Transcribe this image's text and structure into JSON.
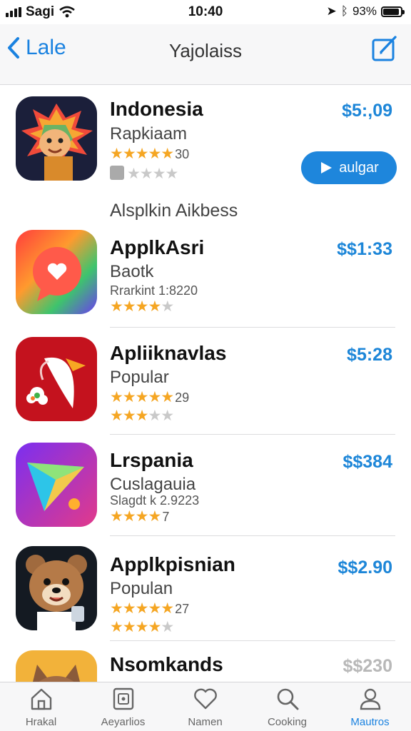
{
  "status_bar": {
    "carrier": "Sagi",
    "time": "10:40",
    "battery": "93%"
  },
  "nav": {
    "back_label": "Lale",
    "title": "Yajolaiss"
  },
  "featured": {
    "title": "Indonesia",
    "subtitle": "Rapkiaam",
    "rating_count": "30",
    "price": "$5:,09",
    "action_label": "aulgar",
    "stars": 5,
    "user_stars": 4
  },
  "section_header": "Alsplkin Aikbess",
  "apps": [
    {
      "title": "ApplkAsri",
      "subtitle": "Baotk",
      "meta": "Rrarkint 1:8220",
      "price": "$$1:33",
      "stars": 4,
      "count": ""
    },
    {
      "title": "Apliiknavlas",
      "subtitle": "Popular",
      "meta": "",
      "price": "$5:28",
      "stars": 5,
      "count": "29",
      "stars2": 3
    },
    {
      "title": "Lrspania",
      "subtitle": "Cuslagauia",
      "meta": "Slagdt k 2.9223",
      "price": "$$384",
      "stars": 4,
      "count": "7"
    },
    {
      "title": "Applkpisnian",
      "subtitle": "Populan",
      "meta": "",
      "price": "$$2.90",
      "stars": 5,
      "count": "27",
      "stars2": 4
    },
    {
      "title": "Nsomkands",
      "subtitle": "",
      "meta": "",
      "price": "$$230",
      "stars": 0,
      "count": ""
    }
  ],
  "tabs": [
    {
      "label": "Hrakal",
      "icon": "home-icon"
    },
    {
      "label": "Aeyarlios",
      "icon": "apps-icon"
    },
    {
      "label": "Namen",
      "icon": "heart-icon"
    },
    {
      "label": "Cooking",
      "icon": "search-icon"
    },
    {
      "label": "Mautros",
      "icon": "profile-icon",
      "active": true
    }
  ],
  "colors": {
    "accent": "#1e86dc",
    "star": "#f5a623"
  }
}
